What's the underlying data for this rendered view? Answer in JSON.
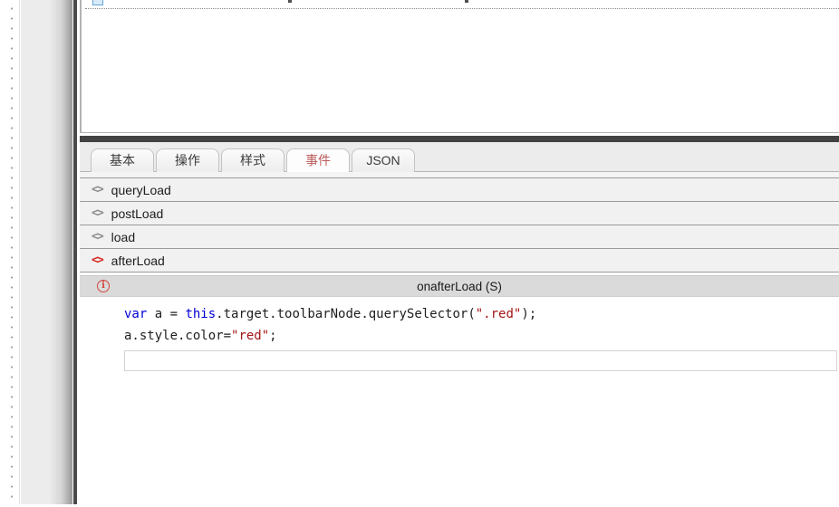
{
  "designer": {
    "top_item_icon": "component-icon"
  },
  "panel": {
    "tabs": [
      {
        "label": "基本",
        "active": false
      },
      {
        "label": "操作",
        "active": false
      },
      {
        "label": "样式",
        "active": false
      },
      {
        "label": "事件",
        "active": true
      },
      {
        "label": "JSON",
        "active": false
      }
    ],
    "events": [
      {
        "label": "queryLoad",
        "has_handler": false
      },
      {
        "label": "postLoad",
        "has_handler": false
      },
      {
        "label": "load",
        "has_handler": false
      },
      {
        "label": "afterLoad",
        "has_handler": true
      }
    ],
    "event_icon_glyph": "<>",
    "handler": {
      "title": "onafterLoad (S)",
      "info_icon_glyph": "i",
      "code": [
        [
          {
            "text": "var",
            "type": "keyword"
          },
          {
            "text": " a = ",
            "type": "plain"
          },
          {
            "text": "this",
            "type": "keyword"
          },
          {
            "text": ".target.toolbarNode.querySelector(",
            "type": "plain"
          },
          {
            "text": "\".red\"",
            "type": "string"
          },
          {
            "text": ");",
            "type": "plain"
          }
        ],
        [
          {
            "text": "a.style.color=",
            "type": "plain"
          },
          {
            "text": "\"red\"",
            "type": "string"
          },
          {
            "text": ";",
            "type": "plain"
          }
        ]
      ]
    }
  },
  "colors": {
    "active_tab_text": "#bb5b5b",
    "event_icon_gray": "#8c8c8c",
    "event_icon_red": "#d6261d",
    "info_icon_red": "#d2453e",
    "code_keyword": "#0000d6",
    "code_string": "#a31515",
    "splitter_dark": "#424242",
    "row_bg": "#f1f1f1",
    "header_bg": "#dadada"
  }
}
